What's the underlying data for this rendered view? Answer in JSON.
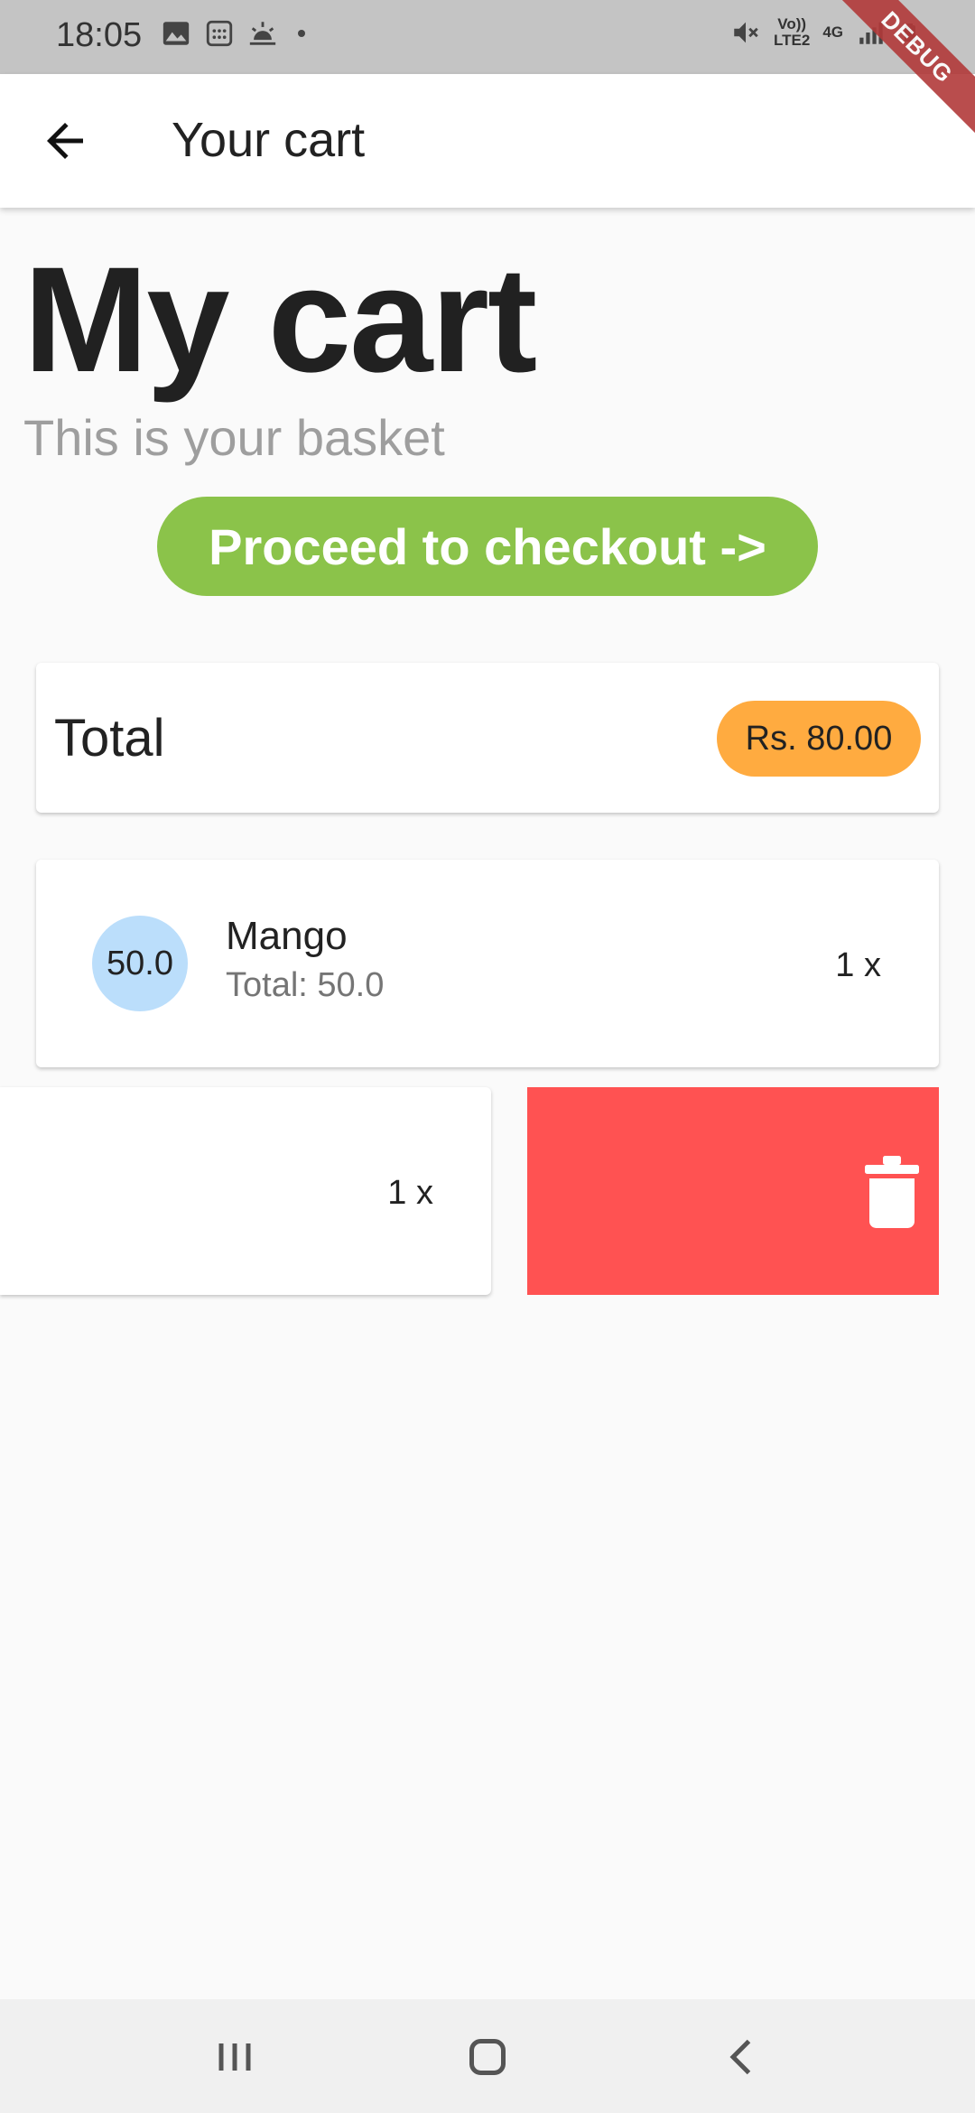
{
  "status_bar": {
    "time": "18:05",
    "net_top": "Vo))",
    "net_bottom": "LTE2",
    "net_type": "4G",
    "icons": [
      "image-icon",
      "calendar-icon",
      "weather-icon",
      "dot-icon",
      "mute-icon",
      "signal-icon",
      "battery-icon"
    ]
  },
  "debug_banner": "DEBUG",
  "app_bar": {
    "title": "Your cart",
    "back_icon": "arrow-back-icon"
  },
  "header": {
    "title": "My cart",
    "subtitle": "This is your basket"
  },
  "checkout_button": "Proceed to checkout  ->",
  "total": {
    "label": "Total",
    "amount": "Rs. 80.00"
  },
  "cart_items": [
    {
      "avatar_text": "50.0",
      "name": "Mango",
      "subtotal": "Total: 50.0",
      "quantity": "1 x"
    },
    {
      "quantity": "1 x",
      "swiped": true
    }
  ],
  "colors": {
    "accent_green": "#8bc34a",
    "total_badge": "#ffab40",
    "avatar_bg": "#bbdefb",
    "delete_red": "#ff5252"
  },
  "nav_bar": [
    "recent-apps-icon",
    "home-icon",
    "back-nav-icon"
  ]
}
